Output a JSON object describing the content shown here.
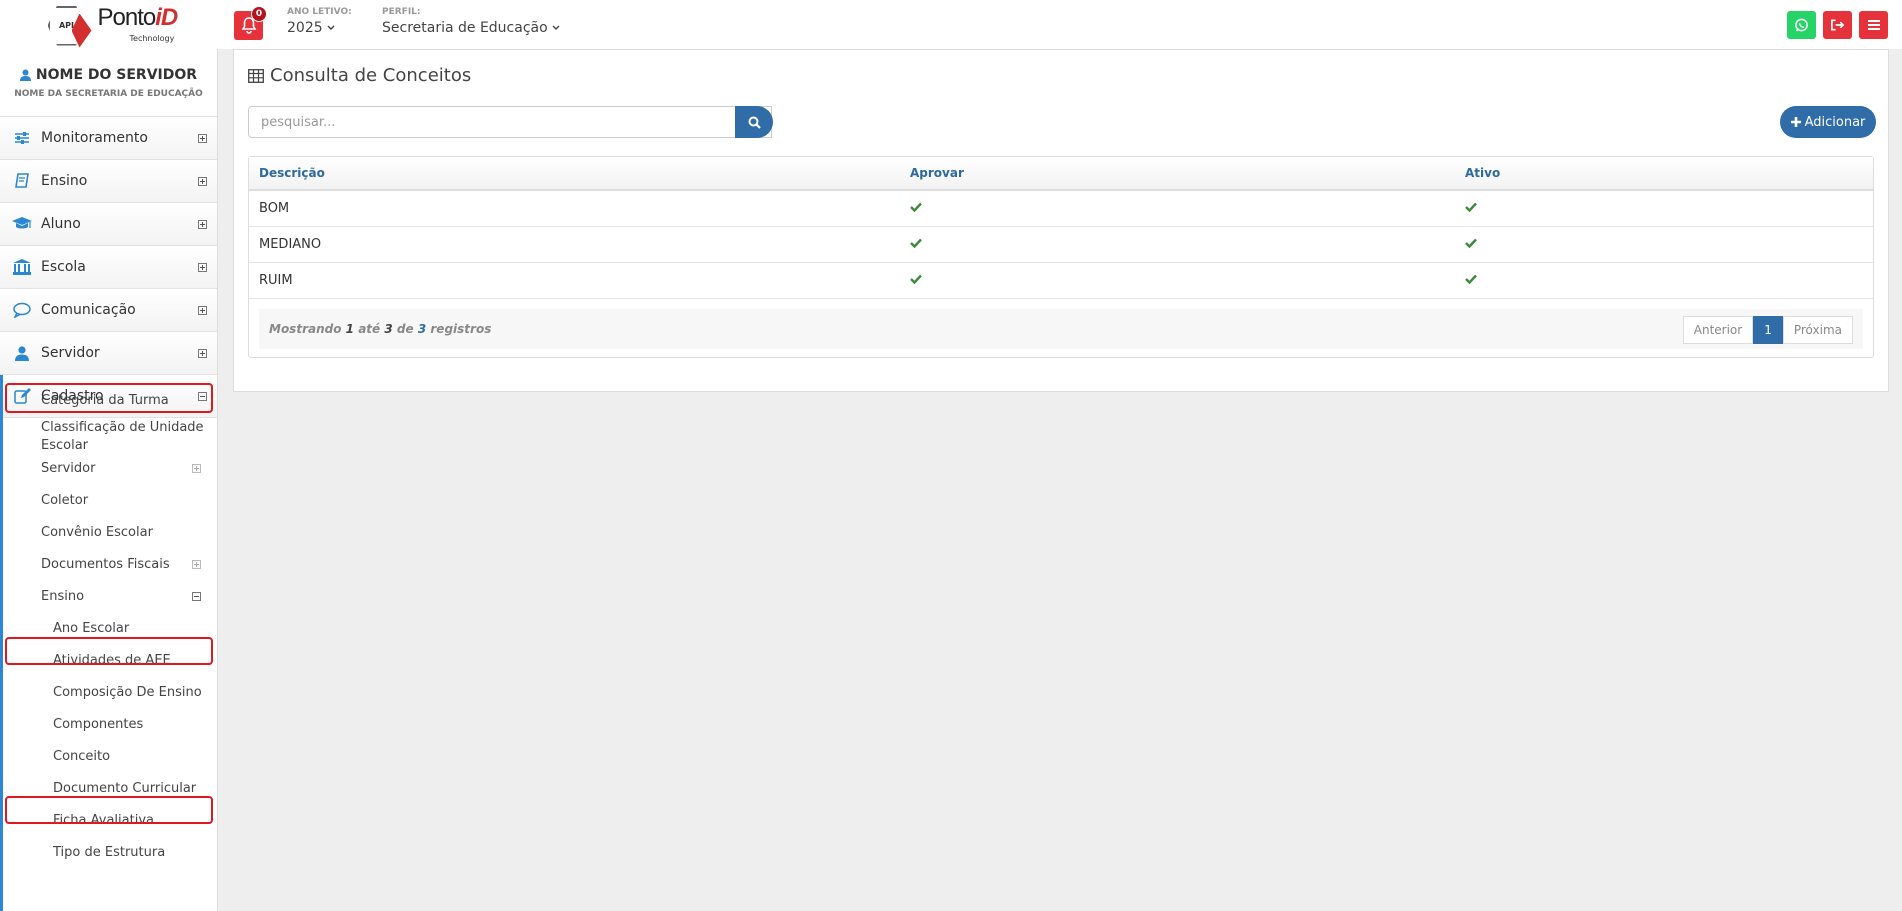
{
  "header": {
    "logo": {
      "badge": "API",
      "name": "Ponto",
      "name_accent": "iD",
      "sub": "Technology"
    },
    "notifications_count": "0",
    "school_year": {
      "label": "ANO LETIVO:",
      "value": "2025"
    },
    "profile": {
      "label": "PERFIL:",
      "value": "Secretaria de Educação"
    },
    "colors": {
      "whatsapp": "#25d366",
      "logout": "#e5323b",
      "menu": "#e5323b"
    }
  },
  "user": {
    "name": "NOME DO SERVIDOR",
    "sub": "NOME DA SECRETARIA DE EDUCAÇÃO"
  },
  "menu": [
    {
      "label": "Monitoramento",
      "icon": "sliders-icon"
    },
    {
      "label": "Ensino",
      "icon": "book-icon"
    },
    {
      "label": "Aluno",
      "icon": "graduation-cap-icon"
    },
    {
      "label": "Escola",
      "icon": "bank-icon"
    },
    {
      "label": "Comunicação",
      "icon": "comment-icon"
    },
    {
      "label": "Servidor",
      "icon": "user-icon"
    },
    {
      "label": "Cadastro",
      "icon": "edit-icon"
    }
  ],
  "submenu": {
    "items": [
      "Categoria da Turma",
      "Classificação de Unidade Escolar",
      "Servidor",
      "Coletor",
      "Convênio Escolar",
      "Documentos Fiscais",
      "Ensino"
    ],
    "ensino_items": [
      "Ano Escolar",
      "Atividades de AEE",
      "Composição De Ensino",
      "Componentes",
      "Conceito",
      "Documento Curricular",
      "Ficha Avaliativa",
      "Tipo de Estrutura"
    ]
  },
  "page": {
    "title": "Consulta de Conceitos",
    "search_placeholder": "pesquisar...",
    "add_label": "Adicionar"
  },
  "table": {
    "headers": [
      "Descrição",
      "Aprovar",
      "Ativo"
    ],
    "rows": [
      {
        "descricao": "BOM",
        "aprovar": "check",
        "ativo": "check"
      },
      {
        "descricao": "MEDIANO",
        "aprovar": "check",
        "ativo": "check"
      },
      {
        "descricao": "RUIM",
        "aprovar": "check",
        "ativo": "check"
      }
    ],
    "footer": {
      "prefix": "Mostrando",
      "from": "1",
      "mid": "até",
      "to": "3",
      "of": "de",
      "total": "3",
      "suffix": "registros"
    },
    "pagination": {
      "prev": "Anterior",
      "current": "1",
      "next": "Próxima"
    }
  },
  "accent_color": "#2f6ca8",
  "highlight_color": "#e0191f"
}
